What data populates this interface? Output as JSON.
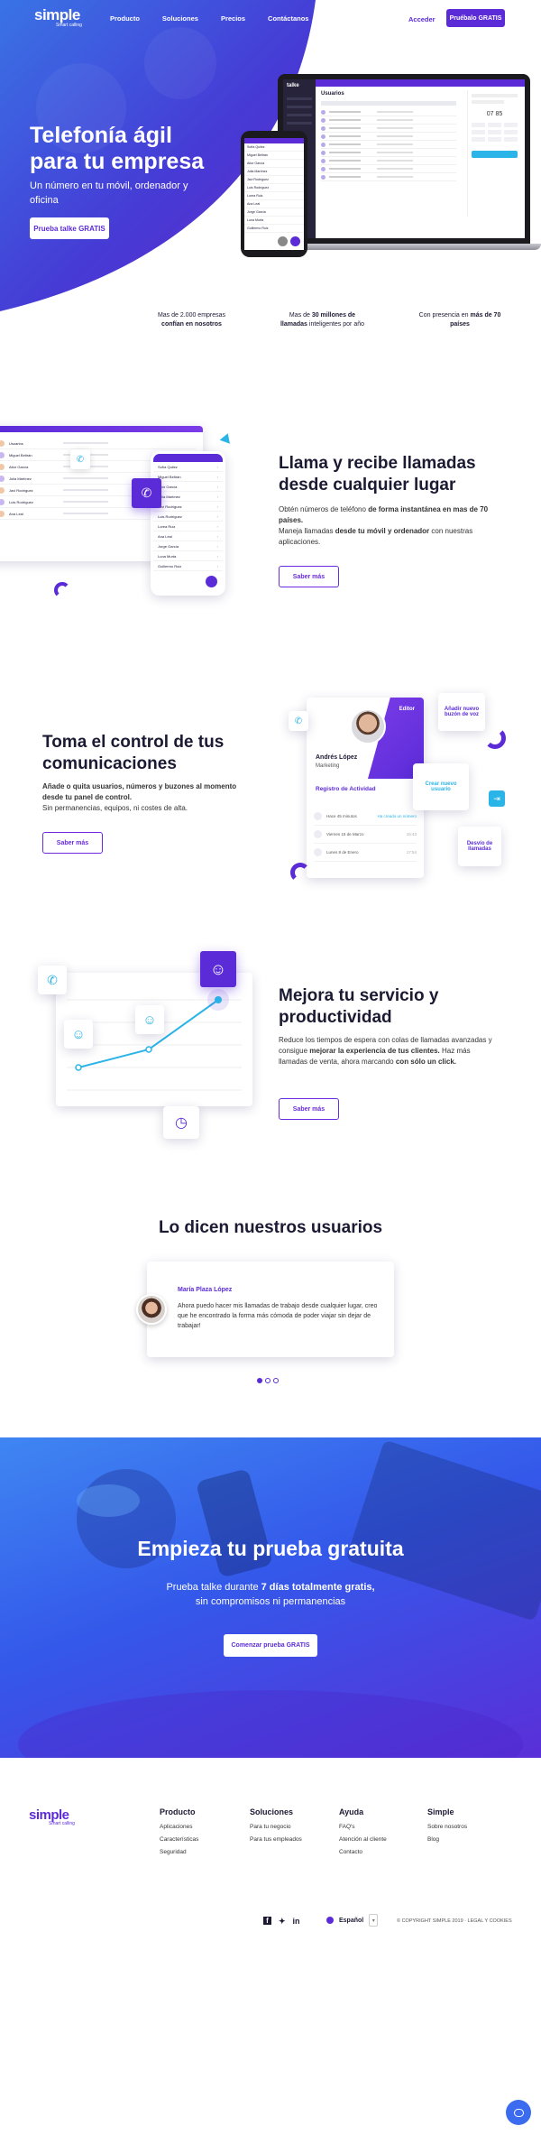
{
  "brand": {
    "name": "simple",
    "tagline": "Smart calling"
  },
  "nav": {
    "items": [
      "Producto",
      "Soluciones",
      "Precios",
      "Contáctanos"
    ],
    "login": "Acceder",
    "cta": "Pruébalo GRATIS"
  },
  "hero": {
    "title_line1": "Telefonía ágil",
    "title_line2": "para tu empresa",
    "subtitle": "Un número en tu móvil, ordenador y oficina",
    "cta": "Prueba talke GRATIS",
    "device": {
      "app_logo": "talke",
      "panel_title": "Usuarios",
      "phone_contacts": [
        "Sofía Quilez",
        "Miguel Beltrán",
        "Aitor García",
        "Julia Martínez",
        "Javi Rodríguez",
        "Luis Rodríguez",
        "Lorea Ruiz",
        "Ana Leal",
        "Jorge García",
        "Luna Murta",
        "Guillermo Ruiz"
      ],
      "panel_rows": 9,
      "dialer_value": "07 85"
    }
  },
  "stats": [
    {
      "pre": "Mas de 2.000 empresas",
      "bold": "confían en nosotros",
      "post": ""
    },
    {
      "pre": "Mas de ",
      "bold": "30 millones de llamadas",
      "post": " inteligentes por año"
    },
    {
      "pre": "Con presencia en ",
      "bold": "más de 70 países",
      "post": ""
    }
  ],
  "feature1": {
    "title": "Llama y recibe llamadas desde cualquier lugar",
    "text_pre": "Obtén números de  teléfono ",
    "text_bold": "de forma instantánea en mas de 70 países.",
    "text2_pre": "Maneja llamadas ",
    "text2_bold": "desde tu móvil y ordenador",
    "text2_post": " con nuestras aplicaciones.",
    "cta": "Saber más",
    "list_names": [
      "Usuarios",
      "Miguel Beltrán",
      "Aitor García",
      "Julia Martínez",
      "Javi Rodríguez",
      "Luis Rodríguez",
      "Ana Leal"
    ],
    "phone_names": [
      "Sofía Quilez",
      "Miguel Beltrán",
      "Aitor García",
      "Julia Martínez",
      "Javi Rodríguez",
      "Luis Rodríguez",
      "Lorea Ruiz",
      "Ana Leal",
      "Jorge García",
      "Luna Murta",
      "Guillermo Ruiz"
    ]
  },
  "feature2": {
    "title": "Toma el control de tus comunicaciones",
    "text_bold": "Añade o quita usuarios, números y buzones al momento desde tu panel de control.",
    "text2": "Sin permanencias, equipos, ni costes de alta.",
    "cta": "Saber más",
    "profile": {
      "name": "Andrés López",
      "dept": "Marketing",
      "role_badge": "Editor",
      "activity_title": "Registro de Actividad",
      "activity": [
        {
          "text": "Hace 45 minutos",
          "detail": "Ha creado un número"
        },
        {
          "text": "Viernes 15 de Marzo",
          "detail": "15:43"
        },
        {
          "text": "Lunes 8 de Enero",
          "detail": "17:54"
        }
      ]
    },
    "bubbles": {
      "b1": "Añadir nuevo buzón de voz",
      "b2": "Crear nuevo usuario",
      "b3": "Desvío de llamadas"
    }
  },
  "feature3": {
    "title": "Mejora tu servicio y productividad",
    "text_pre": "Reduce los tiempos de espera con colas de llamadas avanzadas y consigue ",
    "text_bold": "mejorar la experiencia de tus clientes.",
    "text2_pre": "Haz más llamadas de venta, ahora marcando ",
    "text2_bold": "con sólo un click.",
    "cta": "Saber más"
  },
  "testimonials": {
    "title": "Lo dicen nuestros usuarios",
    "name": "María Plaza López",
    "quote": "Ahora puedo hacer mis llamadas de trabajo desde cualquier lugar, creo que he encontrado la forma más cómoda de poder viajar sin dejar de trabajar!",
    "dots": [
      true,
      false,
      false
    ]
  },
  "trial": {
    "title": "Empieza tu prueba gratuita",
    "line1_pre": "Prueba talke durante ",
    "line1_bold": "7 días totalmente gratis,",
    "line2": "sin compromisos ni permanencias",
    "cta": "Comenzar prueba GRATIS"
  },
  "footer": {
    "columns": [
      {
        "title": "Producto",
        "links": [
          "Aplicaciones",
          "Características",
          "Seguridad"
        ]
      },
      {
        "title": "Soluciones",
        "links": [
          "Para tu negocio",
          "Para tus empleados"
        ]
      },
      {
        "title": "Ayuda",
        "links": [
          "FAQ's",
          "Atención al cliente",
          "Contacto"
        ]
      },
      {
        "title": "Simple",
        "links": [
          "Sobre nosotros",
          "Blog"
        ]
      }
    ],
    "language": "Español",
    "copyright": "© COPYRIGHT SIMPLE 2019  ·  LEGAL Y COOKIES"
  },
  "colors": {
    "primary": "#5b2bd8",
    "accent": "#2bb4e8",
    "blue": "#2e5bf0",
    "dark": "#1c1a33"
  }
}
